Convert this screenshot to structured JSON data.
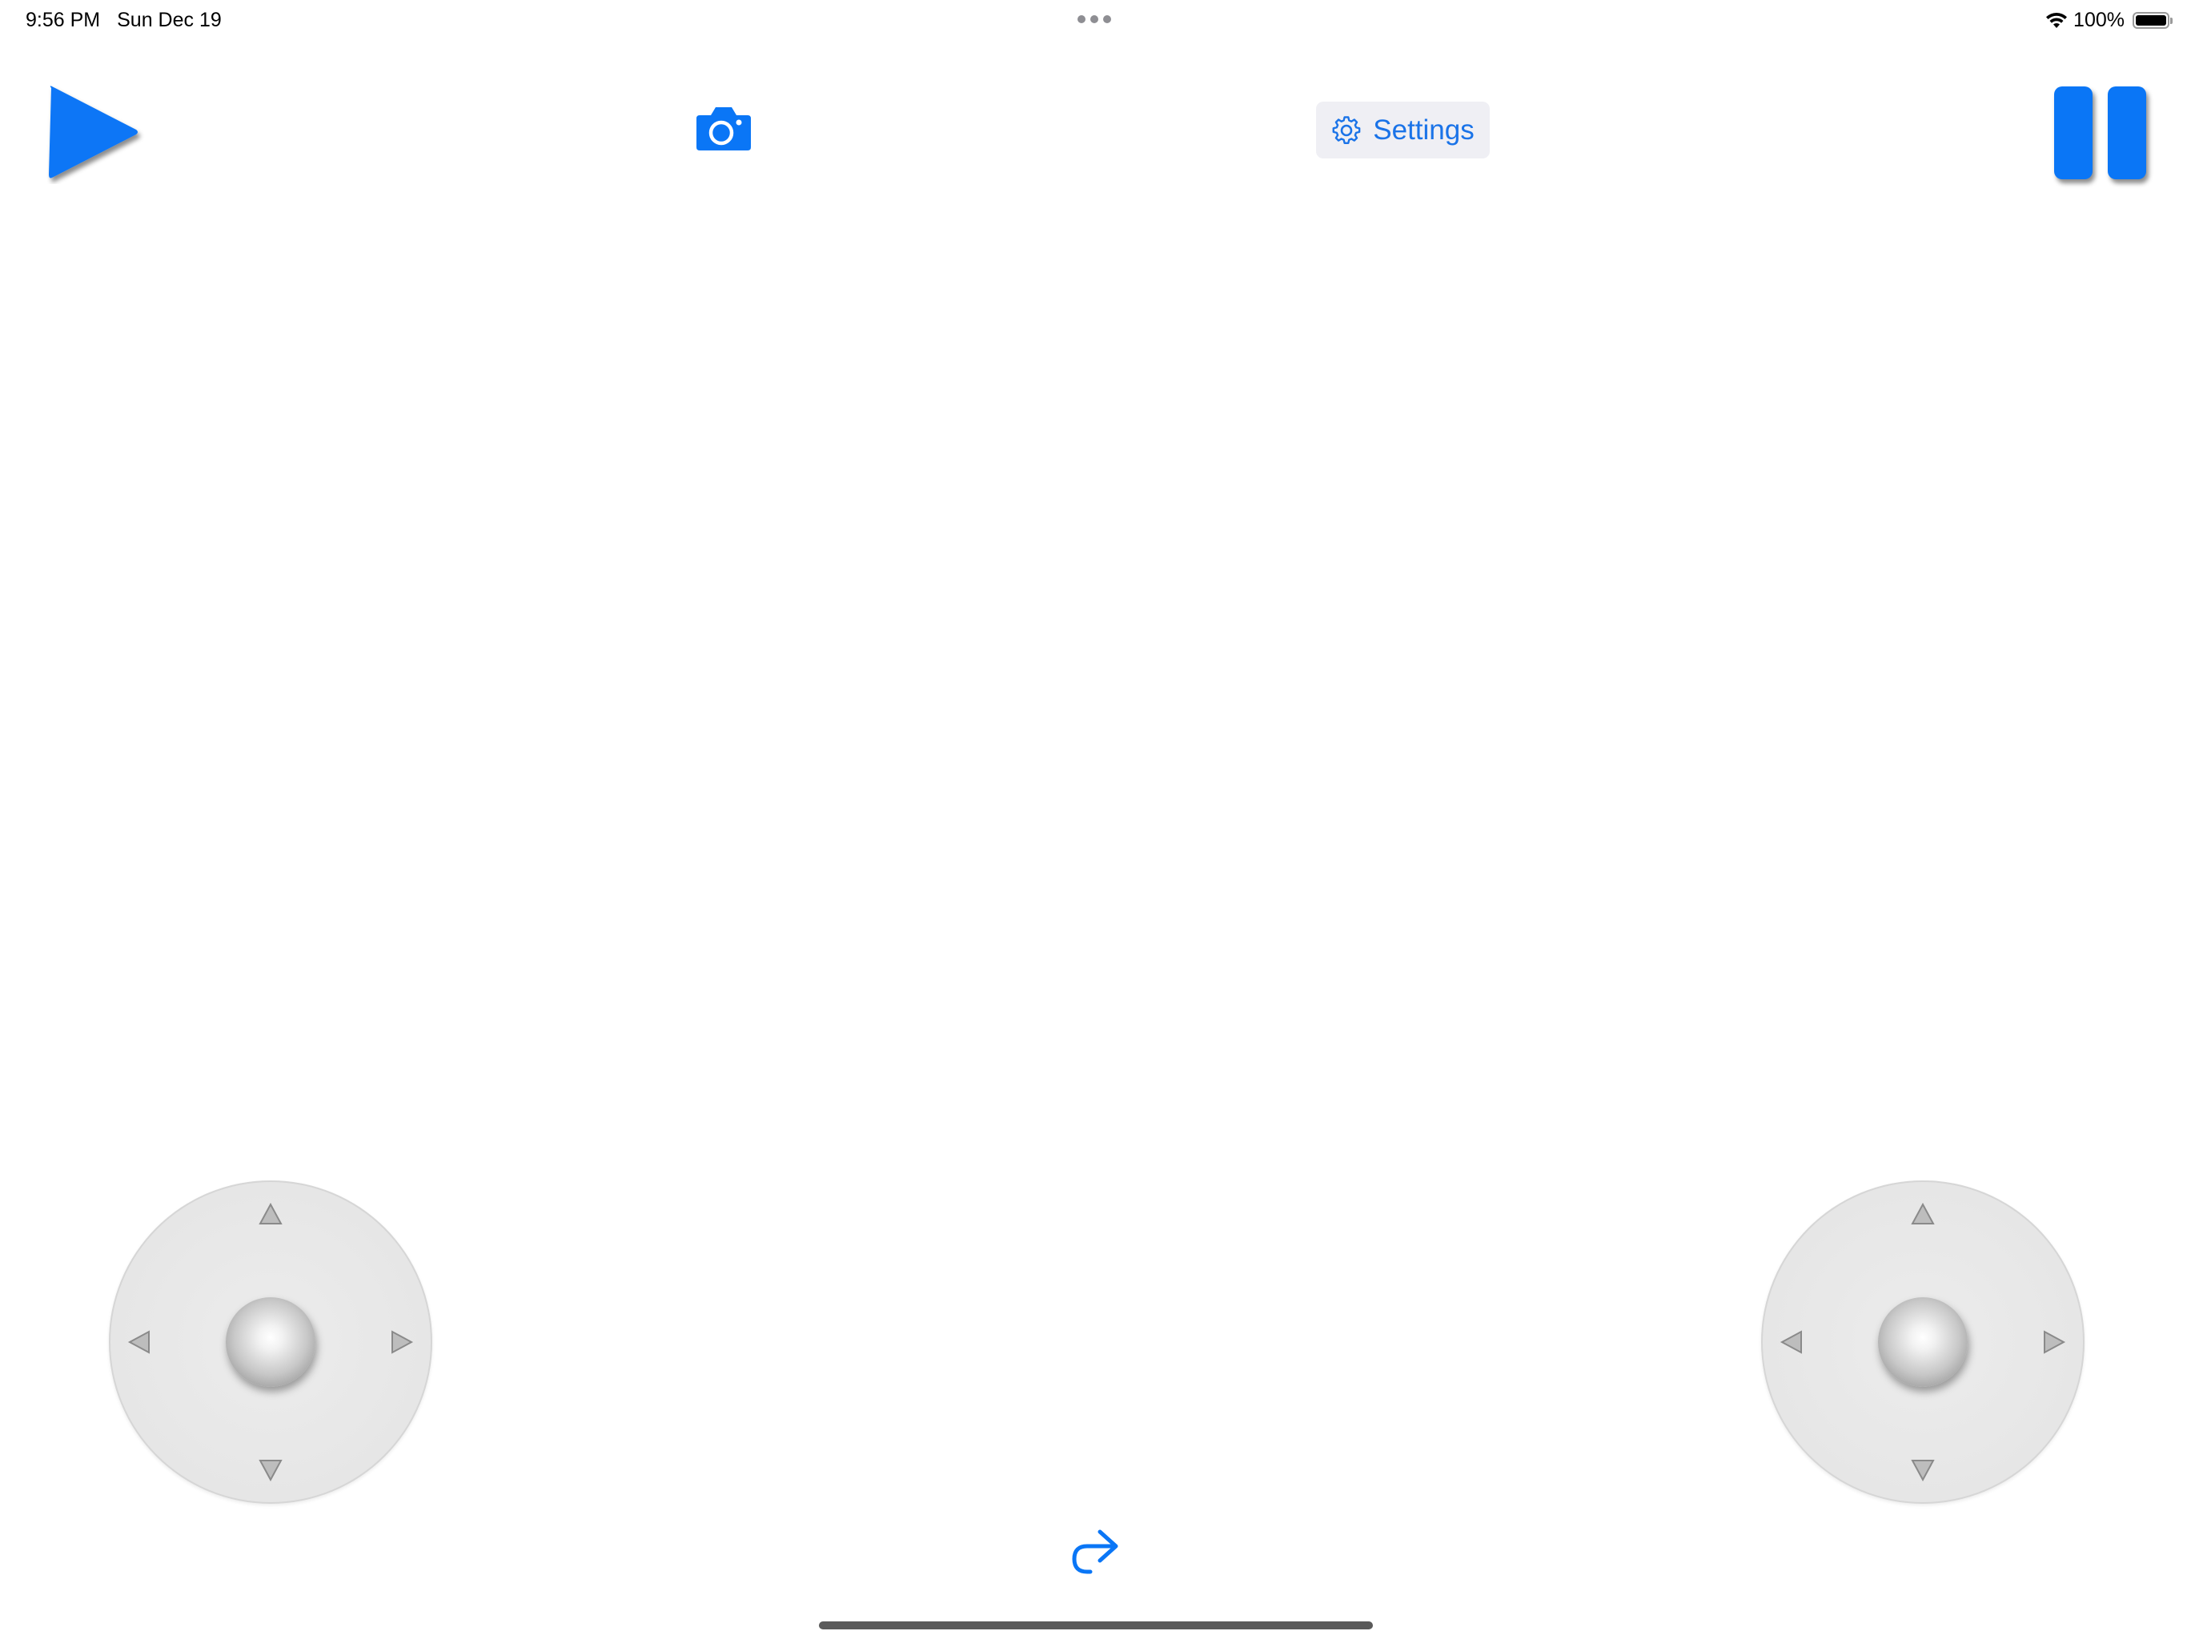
{
  "status_bar": {
    "time": "9:56 PM",
    "date": "Sun Dec 19",
    "battery_text": "100%",
    "icons": [
      "multitasking-dots-icon",
      "wifi-icon",
      "battery-icon"
    ]
  },
  "toolbar": {
    "play_icon": "play-icon",
    "camera_icon": "camera-icon",
    "settings_label": "Settings",
    "settings_icon": "gear-icon",
    "pause_icon": "pause-icon"
  },
  "joysticks": [
    {
      "id": "left",
      "arrows": [
        "up",
        "down",
        "left",
        "right"
      ]
    },
    {
      "id": "right",
      "arrows": [
        "up",
        "down",
        "left",
        "right"
      ]
    }
  ],
  "bottom": {
    "redo_icon": "redo-arrow-icon"
  },
  "colors": {
    "accent": "#0a76f6",
    "settings_text": "#1a73e8",
    "settings_bg": "#efeff4",
    "background": "#ffffff",
    "joystick_base": "#e6e6e6"
  }
}
